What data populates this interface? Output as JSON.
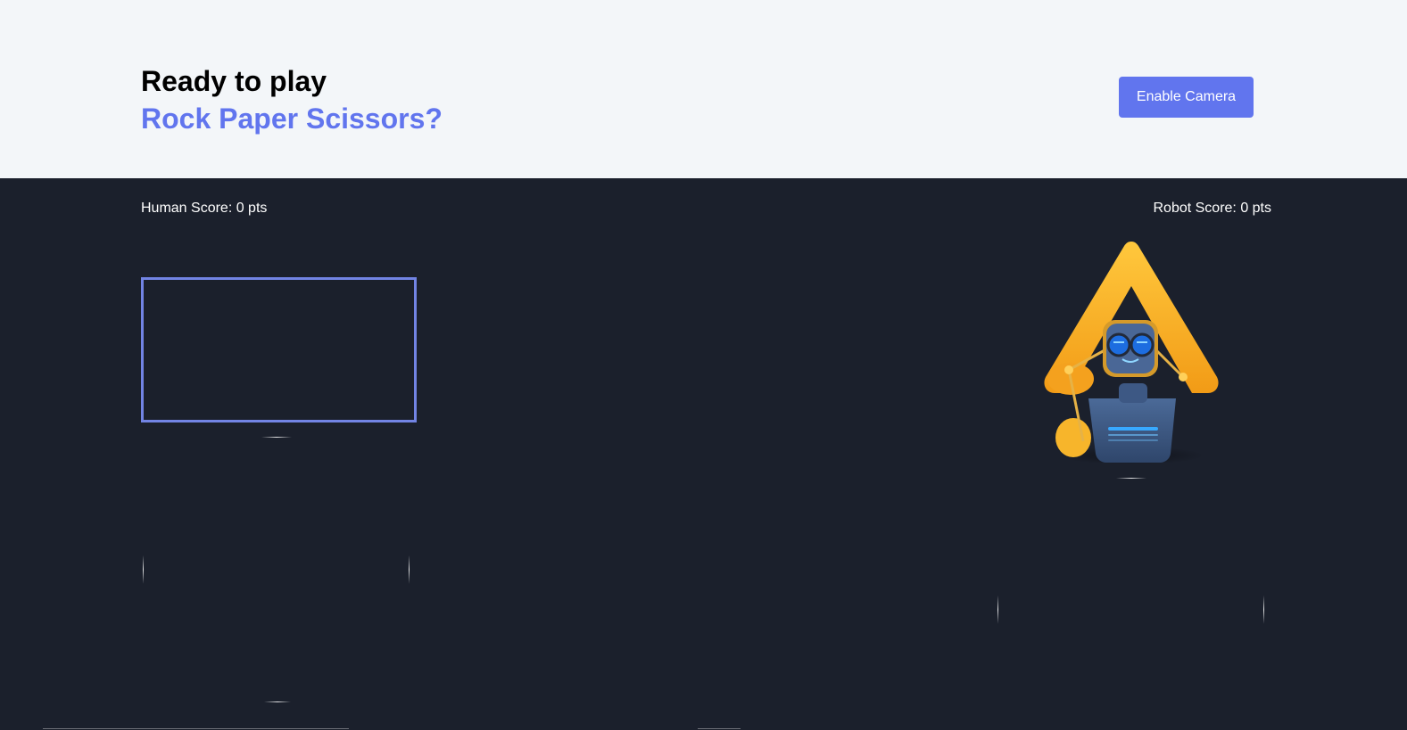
{
  "hero": {
    "line1": "Ready to play",
    "line2": "Rock Paper Scissors?",
    "enable_camera_label": "Enable Camera"
  },
  "scores": {
    "human_label": "Human Score: 0 pts",
    "robot_label": "Robot Score: 0 pts"
  },
  "icons": {
    "robot": "robot-mascot-icon"
  },
  "colors": {
    "accent": "#6175ee",
    "hero_bg": "#f3f6f9",
    "game_bg": "#1b202c",
    "video_border": "#7284e4",
    "robot_triangle": "#f6b02a",
    "robot_body": "#3f5b86"
  }
}
